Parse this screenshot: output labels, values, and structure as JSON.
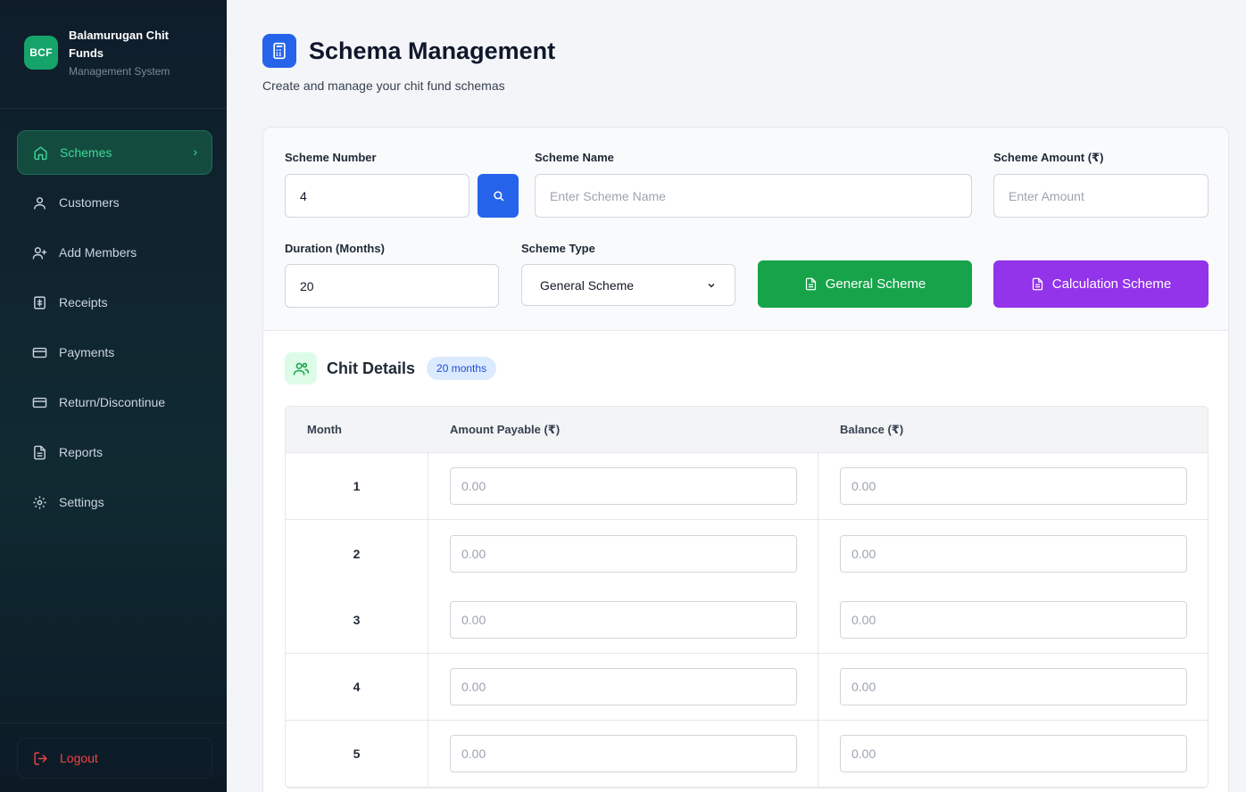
{
  "brand": {
    "logo": "BCF",
    "name": "Balamurugan Chit Funds",
    "subtitle": "Management System"
  },
  "sidebar": {
    "items": [
      {
        "label": "Schemes",
        "icon": "home-icon",
        "active": true
      },
      {
        "label": "Customers",
        "icon": "user-icon"
      },
      {
        "label": "Add Members",
        "icon": "user-plus-icon"
      },
      {
        "label": "Receipts",
        "icon": "receipt-icon"
      },
      {
        "label": "Payments",
        "icon": "card-icon"
      },
      {
        "label": "Return/Discontinue",
        "icon": "card-icon"
      },
      {
        "label": "Reports",
        "icon": "document-icon"
      },
      {
        "label": "Settings",
        "icon": "gear-icon"
      }
    ],
    "chevron": "›",
    "logout": "Logout"
  },
  "header": {
    "title": "Schema Management",
    "subtitle": "Create and manage your chit fund schemas"
  },
  "form": {
    "scheme_number": {
      "label": "Scheme Number",
      "value": "4"
    },
    "scheme_name": {
      "label": "Scheme Name",
      "placeholder": "Enter Scheme Name"
    },
    "scheme_amount": {
      "label": "Scheme Amount (₹)",
      "placeholder": "Enter Amount"
    },
    "duration": {
      "label": "Duration (Months)",
      "value": "20"
    },
    "scheme_type": {
      "label": "Scheme Type",
      "value": "General Scheme"
    },
    "general_button": "General Scheme",
    "calculation_button": "Calculation Scheme"
  },
  "chit": {
    "title": "Chit Details",
    "badge": "20 months",
    "columns": {
      "month": "Month",
      "amount": "Amount Payable (₹)",
      "balance": "Balance (₹)"
    },
    "rows": [
      {
        "month": "1",
        "amount_placeholder": "0.00",
        "balance_placeholder": "0.00"
      },
      {
        "month": "2",
        "amount_placeholder": "0.00",
        "balance_placeholder": "0.00"
      },
      {
        "month": "3",
        "amount_placeholder": "0.00",
        "balance_placeholder": "0.00"
      },
      {
        "month": "4",
        "amount_placeholder": "0.00",
        "balance_placeholder": "0.00"
      },
      {
        "month": "5",
        "amount_placeholder": "0.00",
        "balance_placeholder": "0.00"
      }
    ]
  },
  "colors": {
    "accent": "#2563eb",
    "green": "#16a34a",
    "purple": "#9333ea",
    "active_nav": "#3fd79a",
    "logout": "#ef4444"
  }
}
